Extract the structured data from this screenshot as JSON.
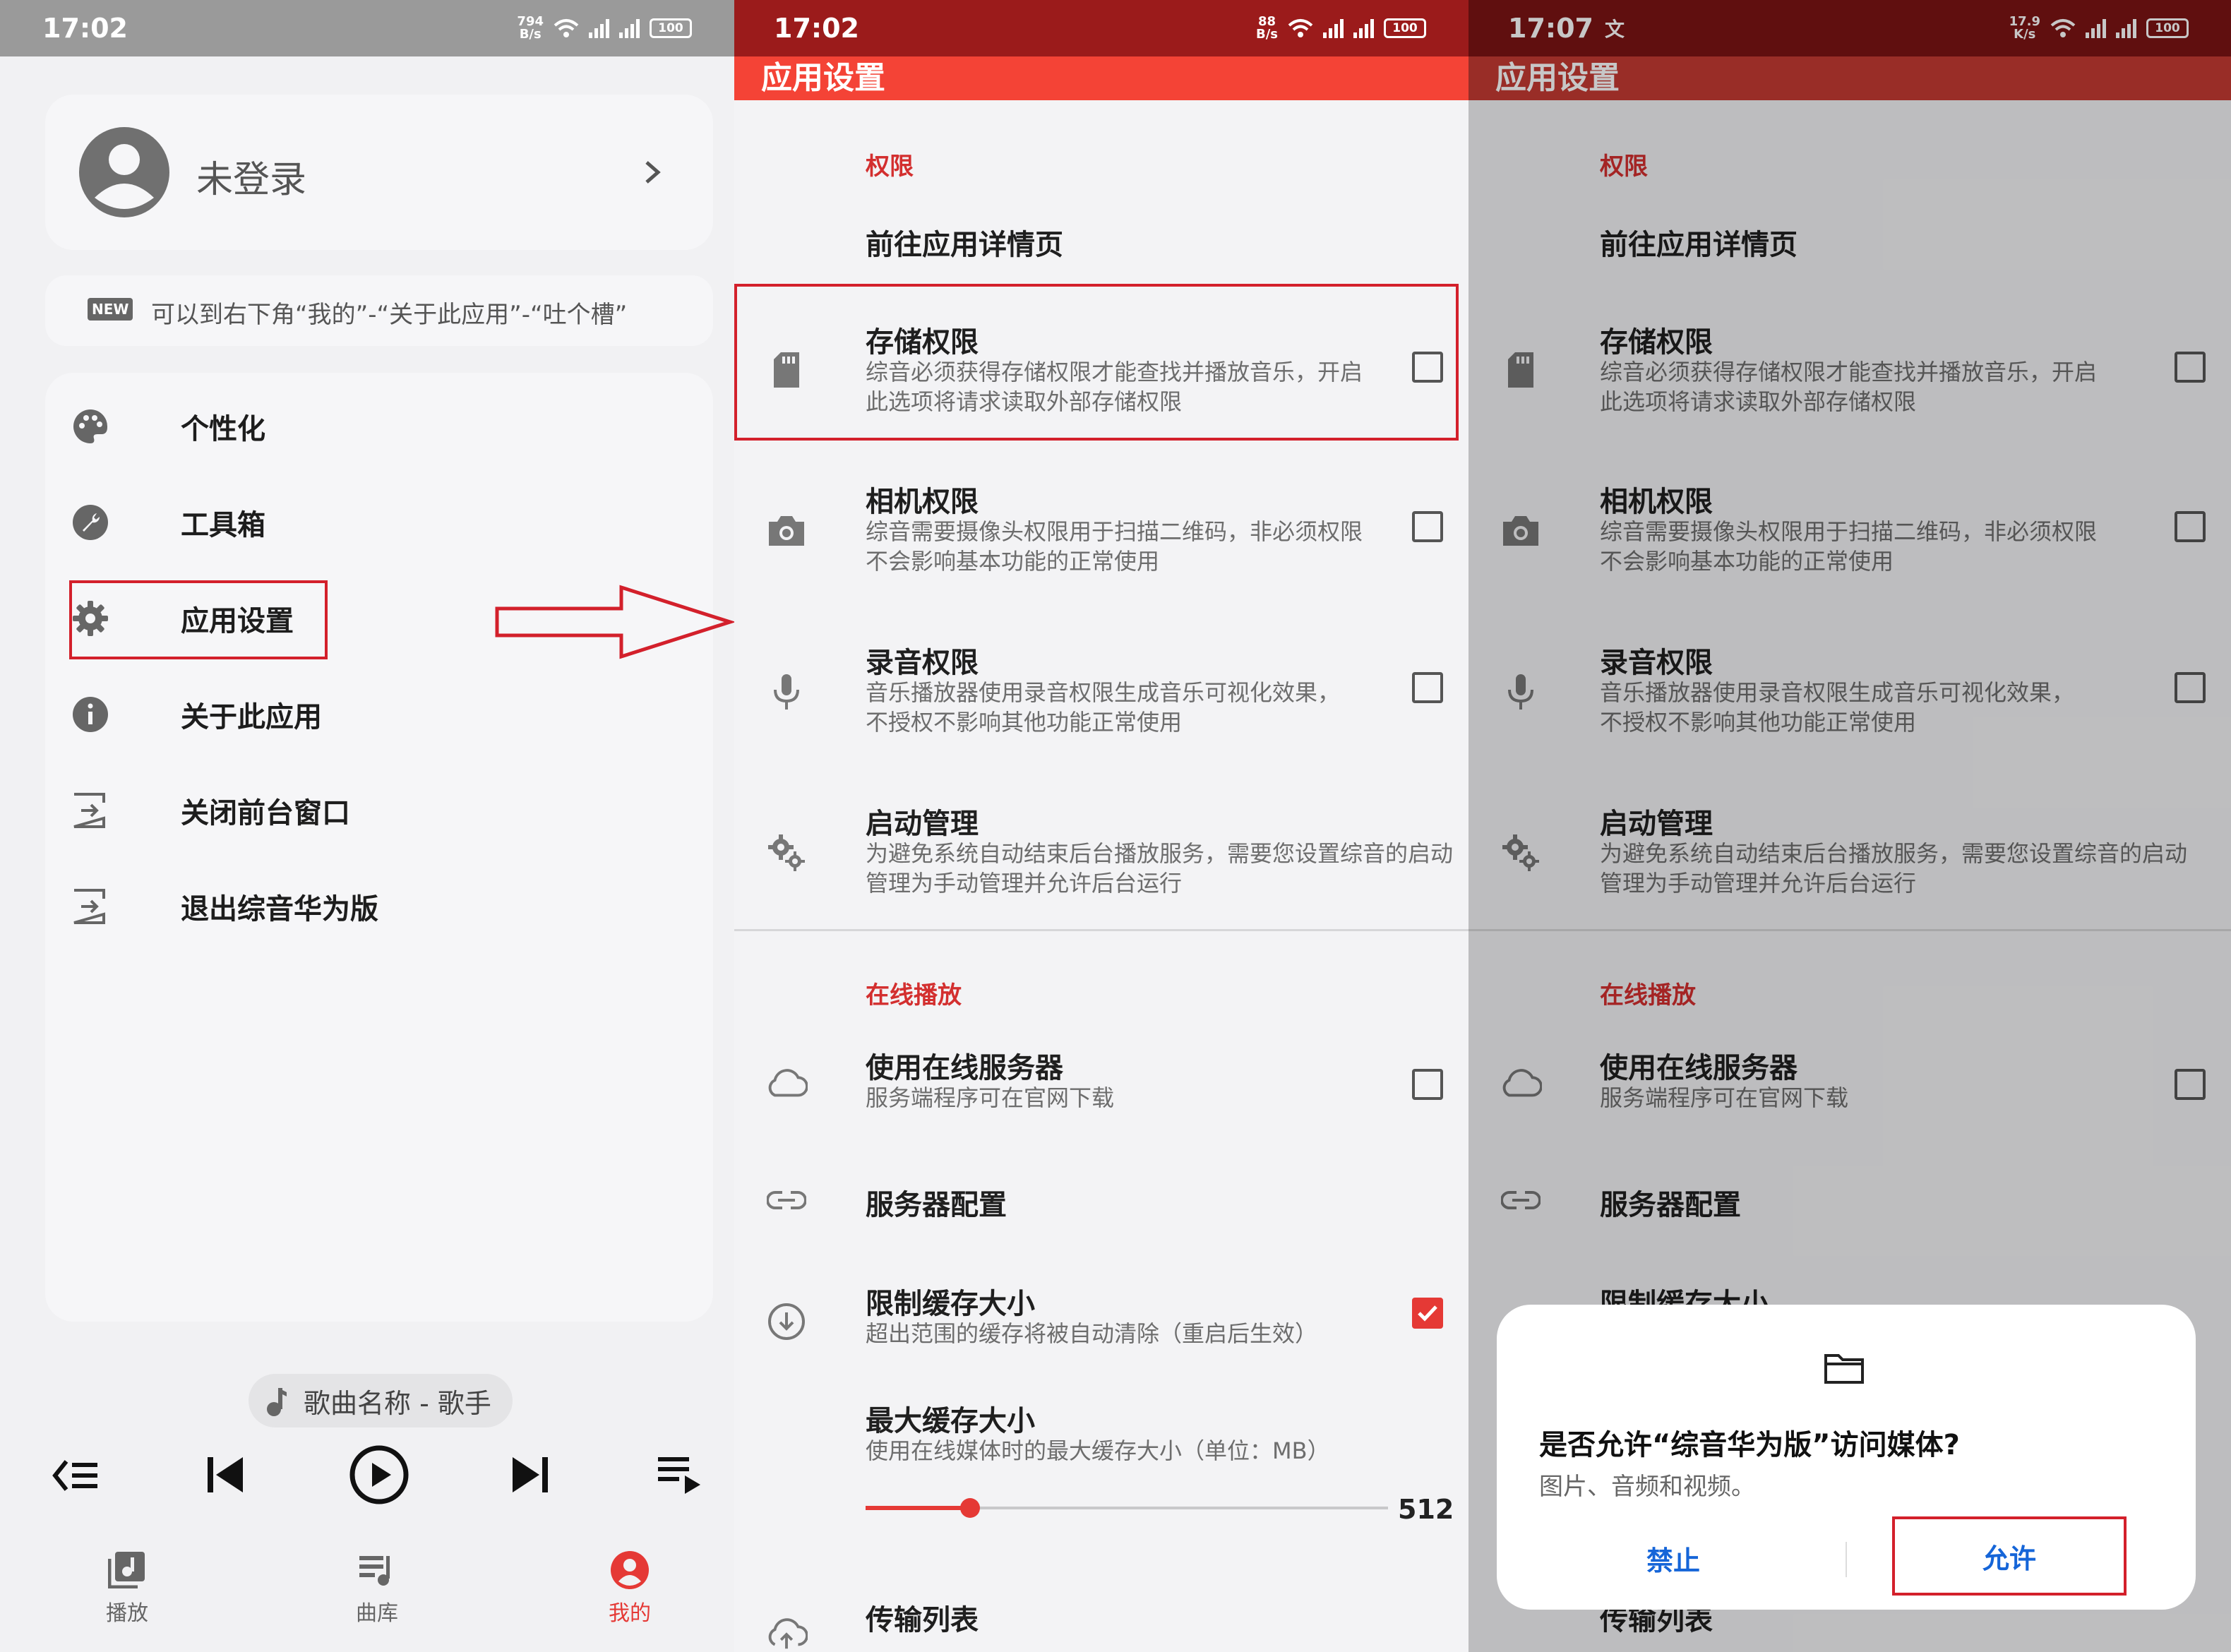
{
  "colors": {
    "accent": "#e53935",
    "statusbar_dark": "#9b1b1b",
    "section": "#d32f2f"
  },
  "panel1": {
    "status": {
      "time": "17:02",
      "speed_value": "794",
      "speed_unit": "B/s",
      "battery": "100"
    },
    "profile": {
      "name": "未登录",
      "avatar_icon": "account-circle-icon",
      "chevron_icon": "chevron-right-icon"
    },
    "notice": {
      "badge": "NEW",
      "text": "可以到右下角“我的”-“关于此应用”-“吐个槽”"
    },
    "menu": [
      {
        "label": "个性化",
        "icon": "palette-icon"
      },
      {
        "label": "工具箱",
        "icon": "wrench-icon"
      },
      {
        "label": "应用设置",
        "icon": "gear-icon"
      },
      {
        "label": "关于此应用",
        "icon": "info-icon"
      },
      {
        "label": "关闭前台窗口",
        "icon": "exit-icon"
      },
      {
        "label": "退出综音华为版",
        "icon": "exit-icon"
      }
    ],
    "now_playing": "歌曲名称 - 歌手",
    "nav": [
      {
        "label": "播放",
        "icon": "music-library-icon"
      },
      {
        "label": "曲库",
        "icon": "queue-music-icon"
      },
      {
        "label": "我的",
        "icon": "account-icon"
      }
    ]
  },
  "panel2": {
    "status": {
      "time": "17:02",
      "speed_value": "88",
      "speed_unit": "B/s",
      "battery": "100"
    },
    "title": "应用设置",
    "sections": {
      "permissions": "权限",
      "online": "在线播放"
    },
    "app_detail": "前往应用详情页",
    "storage": {
      "title": "存储权限",
      "desc": "综音必须获得存储权限才能查找并播放音乐，开启此选项将请求读取外部存储权限"
    },
    "camera": {
      "title": "相机权限",
      "desc": "综音需要摄像头权限用于扫描二维码，非必须权限不会影响基本功能的正常使用"
    },
    "mic": {
      "title": "录音权限",
      "desc": "音乐播放器使用录音权限生成音乐可视化效果，不授权不影响其他功能正常使用"
    },
    "startup": {
      "title": "启动管理",
      "desc": "为避免系统自动结束后台播放服务，需要您设置综音的启动管理为手动管理并允许后台运行"
    },
    "server": {
      "title": "使用在线服务器",
      "desc": "服务端程序可在官网下载"
    },
    "server_config": "服务器配置",
    "cache_limit": {
      "title": "限制缓存大小",
      "desc": "超出范围的缓存将被自动清除（重启后生效）"
    },
    "cache_max": {
      "title": "最大缓存大小",
      "desc": "使用在线媒体时的最大缓存大小（单位：MB）",
      "value": "512",
      "slider_fraction": 0.2
    },
    "transfer": "传输列表"
  },
  "panel3": {
    "status": {
      "time": "17:07",
      "speed_value": "17.9",
      "speed_unit": "K/s",
      "battery": "100",
      "extra_icon": "translate-icon"
    },
    "dialog": {
      "icon": "folder-icon",
      "title": "是否允许“综音华为版”访问媒体?",
      "desc": "图片、音频和视频。",
      "deny": "禁止",
      "allow": "允许"
    }
  }
}
